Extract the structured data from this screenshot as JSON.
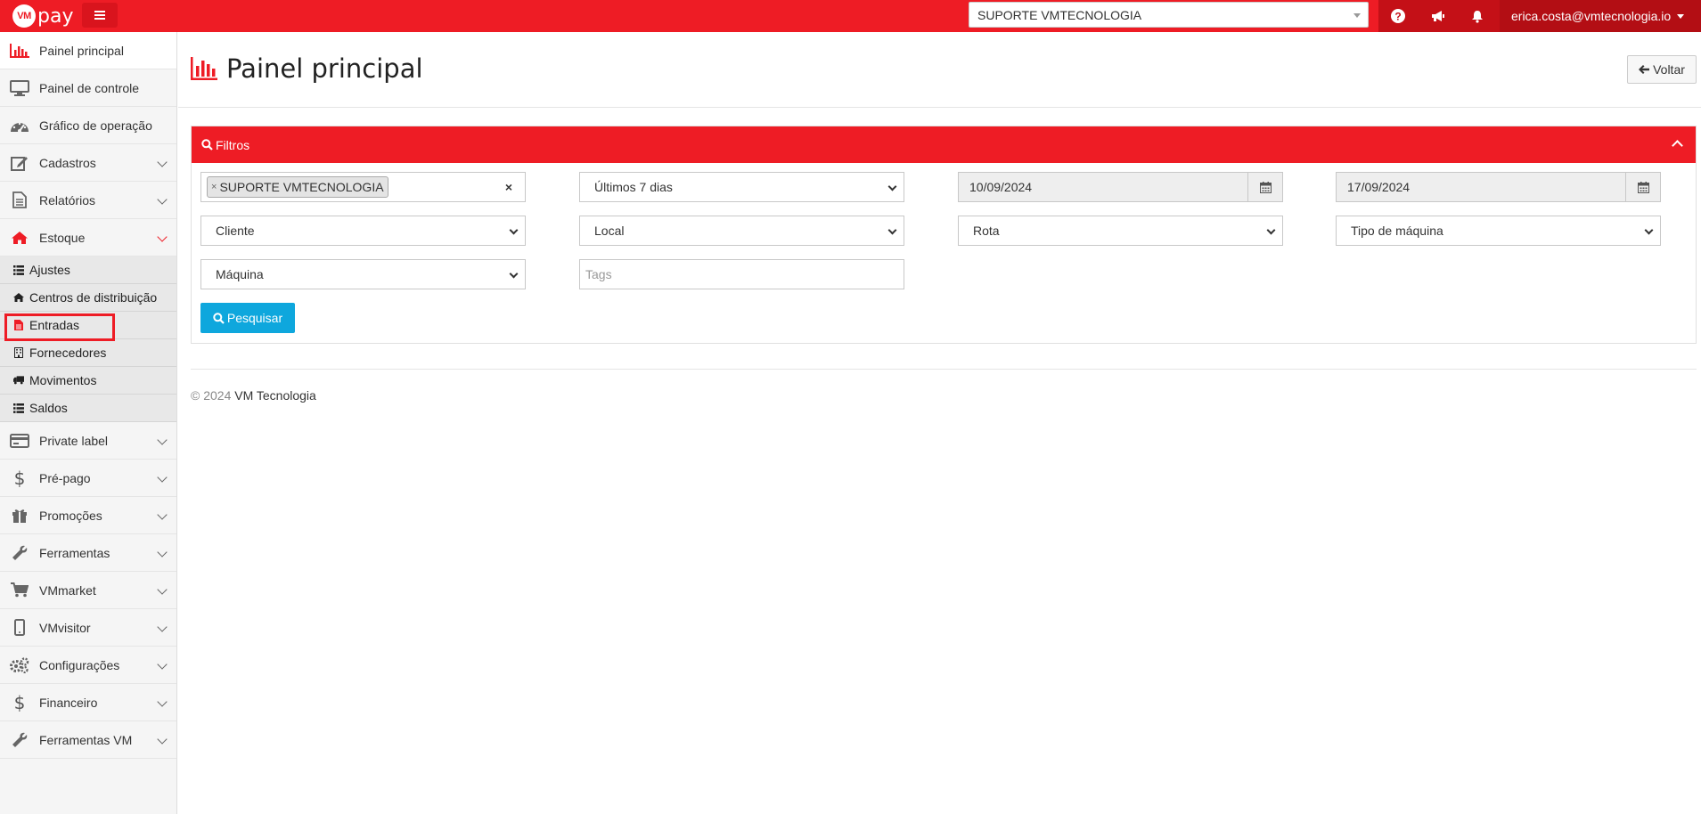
{
  "topbar": {
    "logo_badge": "VM",
    "logo_text": "pay",
    "company_select": "SUPORTE VMTECNOLOGIA",
    "user_email": "erica.costa@vmtecnologia.io",
    "brand_color": "#ee1c25"
  },
  "sidebar": {
    "items": [
      {
        "label": "Painel principal",
        "icon": "bar-chart-icon"
      },
      {
        "label": "Painel de controle",
        "icon": "monitor-icon"
      },
      {
        "label": "Gráfico de operação",
        "icon": "dashboard-icon"
      },
      {
        "label": "Cadastros",
        "icon": "edit-icon"
      },
      {
        "label": "Relatórios",
        "icon": "file-icon"
      },
      {
        "label": "Estoque",
        "icon": "home-icon"
      }
    ],
    "estoque_sub": [
      {
        "label": "Ajustes",
        "icon": "list-icon"
      },
      {
        "label": "Centros de distribuição",
        "icon": "home-icon"
      },
      {
        "label": "Entradas",
        "icon": "document-icon"
      },
      {
        "label": "Fornecedores",
        "icon": "building-icon"
      },
      {
        "label": "Movimentos",
        "icon": "truck-icon"
      },
      {
        "label": "Saldos",
        "icon": "list-icon"
      }
    ],
    "more_items": [
      {
        "label": "Private label",
        "icon": "credit-card-icon"
      },
      {
        "label": "Pré-pago",
        "icon": "dollar-icon"
      },
      {
        "label": "Promoções",
        "icon": "gift-icon"
      },
      {
        "label": "Ferramentas",
        "icon": "wrench-icon"
      },
      {
        "label": "VMmarket",
        "icon": "cart-icon"
      },
      {
        "label": "VMvisitor",
        "icon": "mobile-icon"
      },
      {
        "label": "Configurações",
        "icon": "gears-icon"
      },
      {
        "label": "Financeiro",
        "icon": "dollar-icon"
      },
      {
        "label": "Ferramentas VM",
        "icon": "wrench-icon"
      }
    ]
  },
  "header": {
    "title": "Painel principal",
    "back_label": "Voltar"
  },
  "filters": {
    "title": "Filtros",
    "company_tag": "SUPORTE VMTECNOLOGIA",
    "period": "Últimos 7 dias",
    "date_from": "10/09/2024",
    "date_to": "17/09/2024",
    "cliente": "Cliente",
    "local": "Local",
    "rota": "Rota",
    "tipo_maquina": "Tipo de máquina",
    "maquina": "Máquina",
    "tags_placeholder": "Tags",
    "search_label": "Pesquisar"
  },
  "footer": {
    "copyright": "© 2024",
    "brand": "VM Tecnologia"
  }
}
